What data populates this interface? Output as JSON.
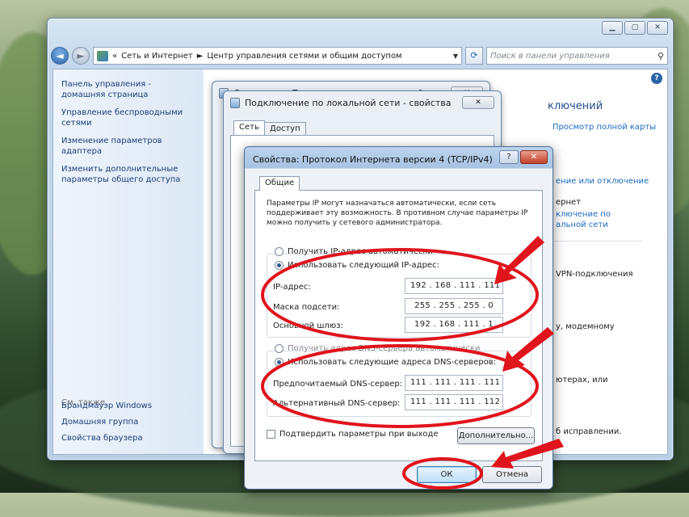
{
  "explorer": {
    "window_controls": [
      "▁",
      "▢",
      "✕"
    ],
    "breadcrumb_prefix": "«",
    "breadcrumb": [
      "Сеть и Интернет",
      "Центр управления сетями и общим доступом"
    ],
    "breadcrumb_sep": "►",
    "search_placeholder": "Поиск в панели управления",
    "sidebar": {
      "links": [
        "Панель управления - домашняя страница",
        "Управление беспроводными сетями",
        "Изменение параметров адаптера",
        "Изменить дополнительные параметры общего доступа"
      ],
      "see_also": "См. также",
      "bottom_links": [
        "Брандмауэр Windows",
        "Домашняя группа",
        "Свойства браузера"
      ]
    },
    "main": {
      "title": "ключений",
      "view_full_map": "Просмотр полной карты",
      "connect_disconnect": "ение или отключение",
      "type_value": "ернет",
      "connection_link_1": "ключение по",
      "connection_link_2": "альной сети",
      "vpn_text": "VPN-подключения",
      "modem_text": "у, модемному",
      "computers_text": "ютерах, или",
      "troubleshoot_text": "б исправлении."
    }
  },
  "status_dialog": {
    "title": "Состояние - Подключение по локальной сети",
    "close": "✕"
  },
  "props_dialog": {
    "title": "Подключение по локальной сети - свойства",
    "close": "✕",
    "tabs": [
      "Сеть",
      "Доступ"
    ]
  },
  "tcp_dialog": {
    "title": "Свойства: Протокол Интернета версии 4 (TCP/IPv4)",
    "help": "?",
    "close": "✕",
    "tab": "Общие",
    "intro": "Параметры IP могут назначаться автоматически, если сеть поддерживает эту возможность. В противном случае параметры IP можно получить у сетевого администратора.",
    "auto_ip": "Получить IP-адрес автоматически",
    "manual_ip": "Использовать следующий IP-адрес:",
    "ip_label": "IP-адрес:",
    "ip_value": "192 . 168 . 111 . 111",
    "mask_label": "Маска подсети:",
    "mask_value": "255 . 255 . 255 .  0",
    "gateway_label": "Основной шлюз:",
    "gateway_value": "192 . 168 . 111 .  1",
    "auto_dns": "Получить адрес DNS-сервера автоматически",
    "manual_dns": "Использовать следующие адреса DNS-серверов:",
    "dns1_label": "Предпочитаемый DNS-сервер:",
    "dns1_value": "111 . 111 . 111 . 111",
    "dns2_label": "Альтернативный DNS-сервер:",
    "dns2_value": "111 . 111 . 111 . 112",
    "validate": "Подтвердить параметры при выходе",
    "advanced": "Дополнительно...",
    "ok": "ОК",
    "cancel": "Отмена"
  },
  "colors": {
    "annotation_red": "#e0141c",
    "link_blue": "#1a6ac2",
    "title_bar": "#bcd3ec"
  }
}
